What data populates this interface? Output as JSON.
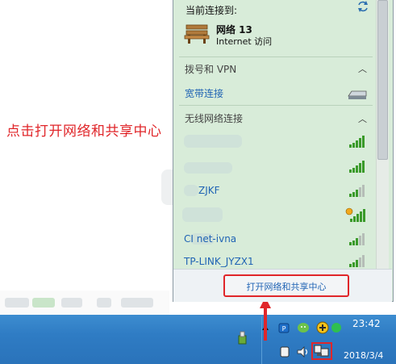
{
  "annotation_text": "点击打开网络和共享中心",
  "popup": {
    "current_connection_label": "当前连接到:",
    "network": {
      "name": "网络 13",
      "status": "Internet 访问"
    },
    "sections": [
      {
        "title": "拨号和 VPN",
        "items": [
          "宽带连接"
        ]
      },
      {
        "title": "无线网络连接"
      }
    ],
    "wifi_items": [
      "",
      "",
      "ZJKF",
      "",
      "CI  net-ivna",
      "TP-LINK_JYZX1"
    ],
    "open_center_button": "打开网络和共享中心"
  },
  "taskbar": {
    "time": "23:42",
    "date": "2018/3/4"
  },
  "colors": {
    "annotation": "#e0262a",
    "link": "#1f63b4",
    "taskbar": "#2f7cc4",
    "popup_bg": "#d8ecd9"
  },
  "icons": [
    "refresh-icon",
    "bench-icon",
    "modem-icon",
    "wifi-signal-icon",
    "wifi-secured-signal-icon",
    "usb-icon",
    "network-tray-icon",
    "volume-icon",
    "wechat-icon",
    "shield-icon",
    "show-hidden-icons-icon"
  ]
}
